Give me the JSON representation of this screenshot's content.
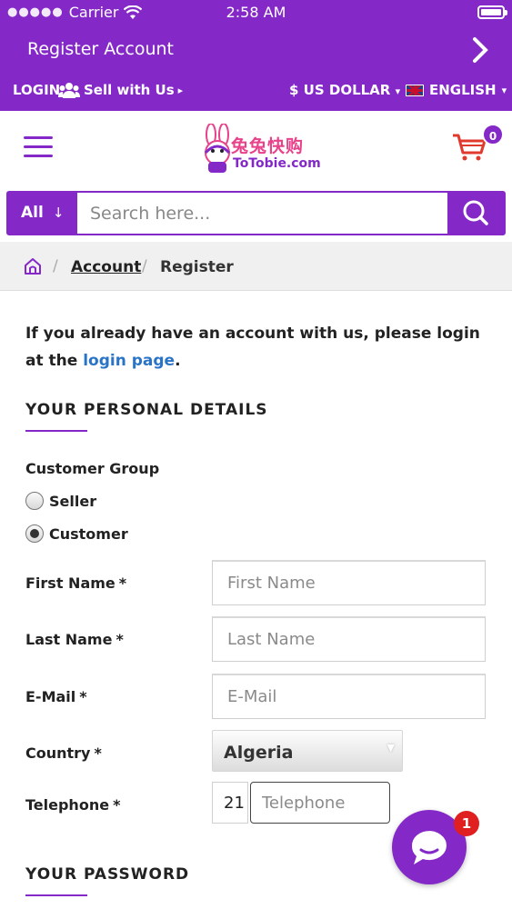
{
  "status_bar": {
    "carrier": "Carrier",
    "time": "2:58 AM"
  },
  "header": {
    "title": "Register Account",
    "login": "LOGIN",
    "sell": "Sell with Us",
    "currency": "$ US DOLLAR",
    "language": "ENGLISH"
  },
  "brand": {
    "logo_cn": "兔兔快购",
    "logo_en": "ToTobie.com",
    "cart_count": "0"
  },
  "search": {
    "category": "All",
    "placeholder": "Search here..."
  },
  "breadcrumb": {
    "account": "Account",
    "current": "Register"
  },
  "intro": {
    "text": "If you already have an account with us, please login at the ",
    "link": "login page",
    "end": "."
  },
  "personal": {
    "heading": "YOUR PERSONAL DETAILS",
    "customer_group_label": "Customer Group",
    "groups": [
      "Seller",
      "Customer"
    ],
    "first_name_label": "First Name",
    "first_name_placeholder": "First Name",
    "last_name_label": "Last Name",
    "last_name_placeholder": "Last Name",
    "email_label": "E-Mail",
    "email_placeholder": "E-Mail",
    "country_label": "Country",
    "country_value": "Algeria",
    "telephone_label": "Telephone",
    "telephone_code": "21",
    "telephone_placeholder": "Telephone",
    "required_mark": "*"
  },
  "password": {
    "heading": "YOUR PASSWORD"
  },
  "chat": {
    "badge": "1"
  },
  "colors": {
    "accent": "#8429c8",
    "link": "#2a74c7",
    "badge": "#e02020"
  }
}
